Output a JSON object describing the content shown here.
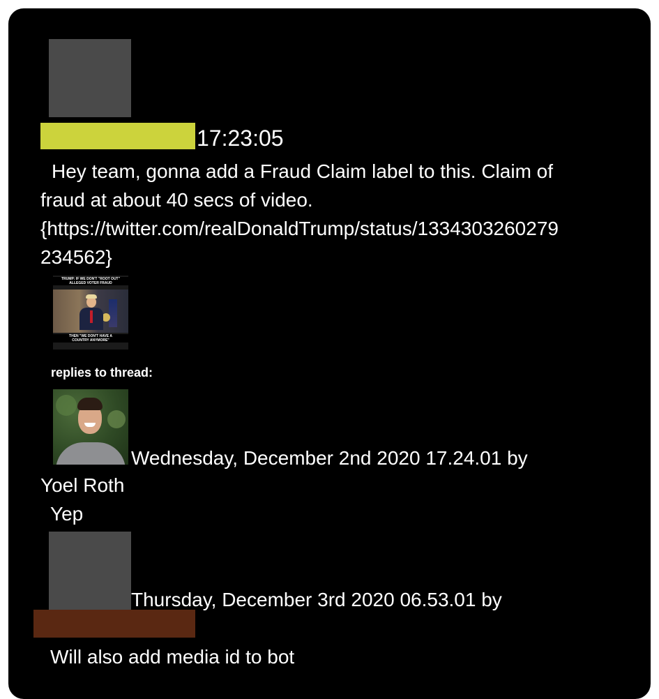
{
  "post": {
    "time": "17:23:05",
    "message_lines": [
      "Hey team, gonna add a Fraud Claim label to this. Claim of",
      "fraud at about 40 secs of video.",
      "{https://twitter.com/realDonaldTrump/status/1334303260279",
      "234562}"
    ],
    "thumbnail": {
      "top_caption": "TRUMP: IF WE DON'T \"ROOT OUT\" ALLEGED VOTER FRAUD",
      "bottom_caption": "THEN \"WE DON'T HAVE A COUNTRY ANYMORE\""
    }
  },
  "thread": {
    "heading": "replies to thread:",
    "replies": [
      {
        "meta": "Wednesday, December 2nd 2020 17.24.01 by",
        "author": "Yoel Roth",
        "text": "Yep"
      },
      {
        "meta": "Thursday, December 3rd 2020 06.53.01 by",
        "author": "",
        "text": "Will also add media id to bot"
      }
    ]
  },
  "colors": {
    "background": "#000000",
    "redaction_yellow": "#ccd33c",
    "redaction_brown": "#5a2812",
    "redacted_avatar": "#4a4a4a",
    "text": "#ffffff"
  }
}
